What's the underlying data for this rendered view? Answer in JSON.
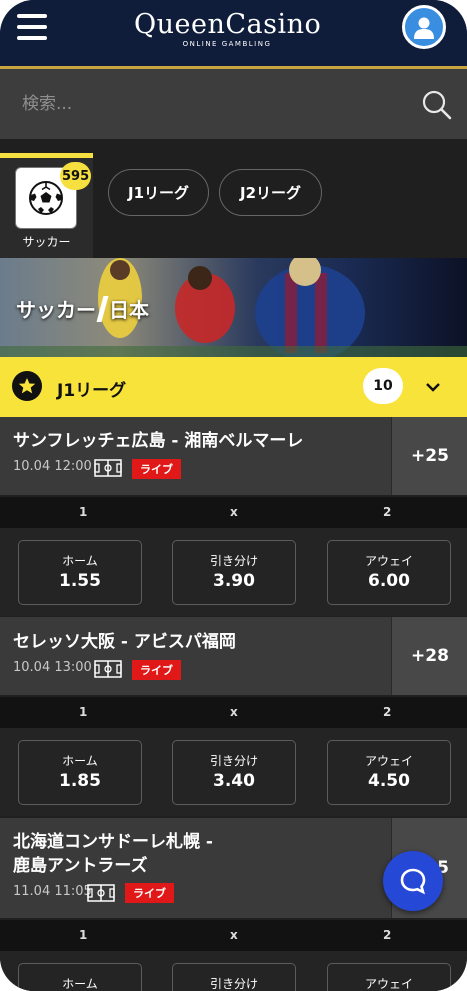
{
  "header": {
    "logo_main": "QueenCasino",
    "logo_sub": "ONLINE GAMBLING",
    "menu_icon": "hamburger-icon",
    "user_icon": "user-icon"
  },
  "search": {
    "placeholder": "検索...",
    "icon": "search-icon"
  },
  "categories": {
    "active": {
      "label": "サッカー",
      "count": "595",
      "icon": "soccer-ball-icon"
    },
    "pills": [
      "J1リーグ",
      "J2リーグ"
    ]
  },
  "banner": {
    "title_part1": "サッカー",
    "title_part2": "日本"
  },
  "league": {
    "name": "J1リーグ",
    "count": "10"
  },
  "matches": [
    {
      "title": "サンフレッチェ広島 - 湘南ベルマーレ",
      "time": "10.04 12:00",
      "live": "ライブ",
      "more": "+25",
      "cols": [
        "1",
        "x",
        "2"
      ],
      "odds": [
        {
          "label": "ホーム",
          "value": "1.55"
        },
        {
          "label": "引き分け",
          "value": "3.90"
        },
        {
          "label": "アウェイ",
          "value": "6.00"
        }
      ]
    },
    {
      "title": "セレッソ大阪 - アビスパ福岡",
      "time": "10.04 13:00",
      "live": "ライブ",
      "more": "+28",
      "cols": [
        "1",
        "x",
        "2"
      ],
      "odds": [
        {
          "label": "ホーム",
          "value": "1.85"
        },
        {
          "label": "引き分け",
          "value": "3.40"
        },
        {
          "label": "アウェイ",
          "value": "4.50"
        }
      ]
    },
    {
      "title_line1": "北海道コンサドーレ札幌 -",
      "title_line2": "鹿島アントラーズ",
      "time": "11.04 11:05",
      "live": "ライブ",
      "more": "+25",
      "cols": [
        "1",
        "x",
        "2"
      ],
      "odds": [
        {
          "label": "ホーム"
        },
        {
          "label": "引き分け"
        },
        {
          "label": "アウェイ"
        }
      ]
    }
  ],
  "chat": {
    "icon": "chat-bubble-icon"
  },
  "colors": {
    "header_bg": "#0f1d3b",
    "accent_yellow": "#f8e33b",
    "live_red": "#e01818",
    "chat_blue": "#2648d6"
  }
}
